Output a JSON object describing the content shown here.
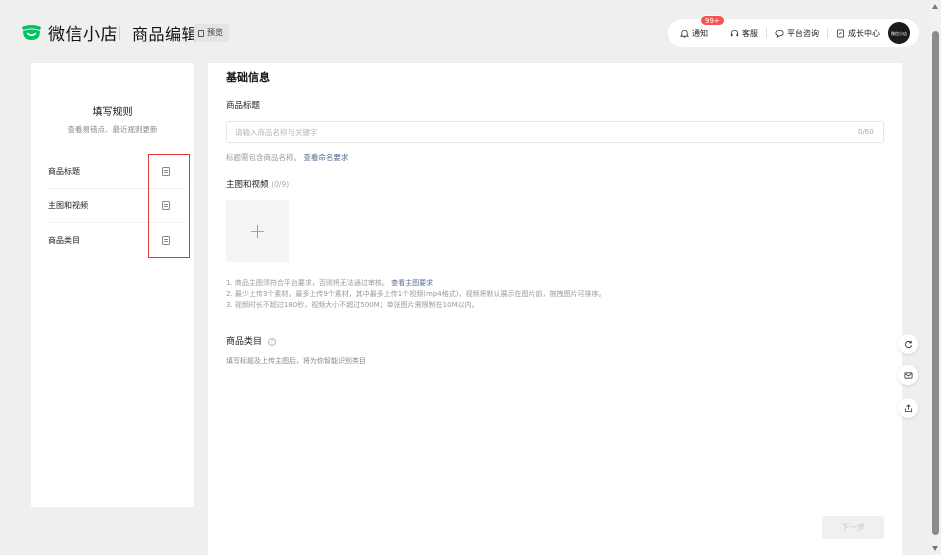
{
  "header": {
    "brand": "微信小店",
    "page_title": "商品编辑",
    "preview_label": "预览",
    "actions": {
      "notify_label": "通知",
      "notify_badge": "99+",
      "service_label": "客服",
      "consult_label": "平台咨询",
      "growth_label": "成长中心",
      "avatar_text": "微信小店"
    }
  },
  "rules": {
    "title": "填写规则",
    "subtitle": "查看易错点、最近规则更新",
    "items": [
      {
        "label": "商品标题"
      },
      {
        "label": "主图和视频"
      },
      {
        "label": "商品类目"
      }
    ]
  },
  "main": {
    "section_title": "基础信息",
    "title_field": {
      "label": "商品标题",
      "placeholder": "请输入商品名称与关键字",
      "counter": "0/60",
      "hint": "标题需包含商品名称。",
      "hint_link": "查看命名要求"
    },
    "media": {
      "label": "主图和视频",
      "count": "(0/9)",
      "upload_symbol": "+",
      "note1": "1. 商品主图须符合平台要求，否则将无法通过审核。",
      "note1_link": "查看主图要求",
      "note2": "2. 最少上传3个素材，最多上传9个素材，其中最多上传1个视频(mp4格式)，视频将默认展示在图片前，拖拽图片可排序。",
      "note3": "3. 视频时长不超过180秒，视频大小不超过500M；单张图片需限制在10M以内。"
    },
    "category": {
      "label": "商品类目",
      "help": "?",
      "hint": "填写标题及上传主图后，将为你智能识别类目"
    },
    "next_button": "下一步"
  },
  "colors": {
    "brand_green": "#07c160",
    "link_blue": "#576b95",
    "badge_red": "#fa5151",
    "highlight_red": "#e33b3b"
  }
}
